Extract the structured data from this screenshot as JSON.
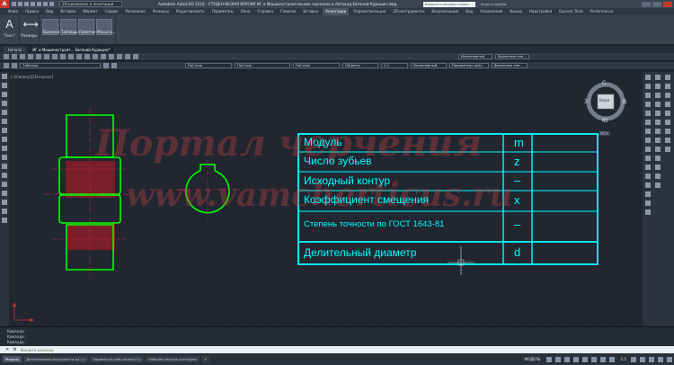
{
  "titlebar": {
    "workspace": "2D-рисование и аннотации",
    "title": "Autodesk AutoCAD 2016 - СТУДЕНЧЕСКАЯ ВЕРСИЯ   ИГ и Машиностроительное черчение в Автокад   Евгений Курицин.dwg",
    "search_placeholder": "Введите ключевое слово/фразу",
    "user": "Вход в службы"
  },
  "ribbon_tabs": [
    "Файл",
    "Правка",
    "Вид",
    "Вставка",
    "Формат",
    "Сервис",
    "Рисование",
    "Размеры",
    "Редактировать",
    "Параметры",
    "Окно",
    "Справка",
    "Главная",
    "Вставка",
    "Аннотации",
    "Параметризация",
    "3D-инструменты",
    "Визуализация",
    "Вид",
    "Управление",
    "Вывод",
    "Надстройки",
    "Express Tools",
    "Performance"
  ],
  "ribbon_active_tab": "Аннотации",
  "ribbon": {
    "text_label": "Текст",
    "dims_label": "Размеры",
    "groups": [
      "Выноски",
      "Таблицы",
      "Пометки",
      "Масшта..."
    ]
  },
  "doc_tabs": [
    "Начало",
    "ИГ и Машиностроит... Евгений Курицин*"
  ],
  "toolbar1": {
    "textstyle": "Инженерный",
    "dimstyle": "Выносные эле..."
  },
  "toolbar2": {
    "layer": "Таблицы",
    "color": "ПоСлою",
    "linetype": "ПоСлою",
    "lineweight": "ПоСлою",
    "plotstyle": "ПоЦвету",
    "ann_scale": "1:1",
    "style2": "Инженерный",
    "params": "Параметры цели",
    "mleader": "Выносные эле..."
  },
  "viewport_label": "[-][Сверху][2D-каркас]",
  "viewcube": {
    "top": "Верх",
    "n": "С",
    "s": "Ю",
    "w": "З",
    "e": "В",
    "wcs": "МСК"
  },
  "watermark": {
    "line1": "Портал черчения",
    "line2": "www.vamcherticus.ru"
  },
  "table": {
    "rows": [
      {
        "name": "Модуль",
        "symbol": "m",
        "value": ""
      },
      {
        "name": "Число зубьев",
        "symbol": "z",
        "value": ""
      },
      {
        "name": "Исходный контур",
        "symbol": "–",
        "value": ""
      },
      {
        "name": "Коэффициент смещения",
        "symbol": "x",
        "value": ""
      },
      {
        "name": "Степень точности по ГОСТ 1643-81",
        "symbol": "–",
        "value": ""
      },
      {
        "name": "Делительный диаметр",
        "symbol": "d",
        "value": ""
      }
    ]
  },
  "command_history": [
    "Команда :",
    "Команда :",
    "Команда :"
  ],
  "command_placeholder": "Введите команду",
  "layout_tabs": [
    "Модель",
    "Делительный окружности А4 (1)",
    "Параметры зубч.колеса (1)",
    "Рабочий чертеж шестерни",
    "+"
  ],
  "status": {
    "model": "МОДЕЛЬ",
    "scale": "1:1"
  },
  "colors": {
    "cyan": "#00ffff",
    "green": "#00ff00",
    "hatch": "#7a1e2a",
    "bg": "#212630"
  }
}
